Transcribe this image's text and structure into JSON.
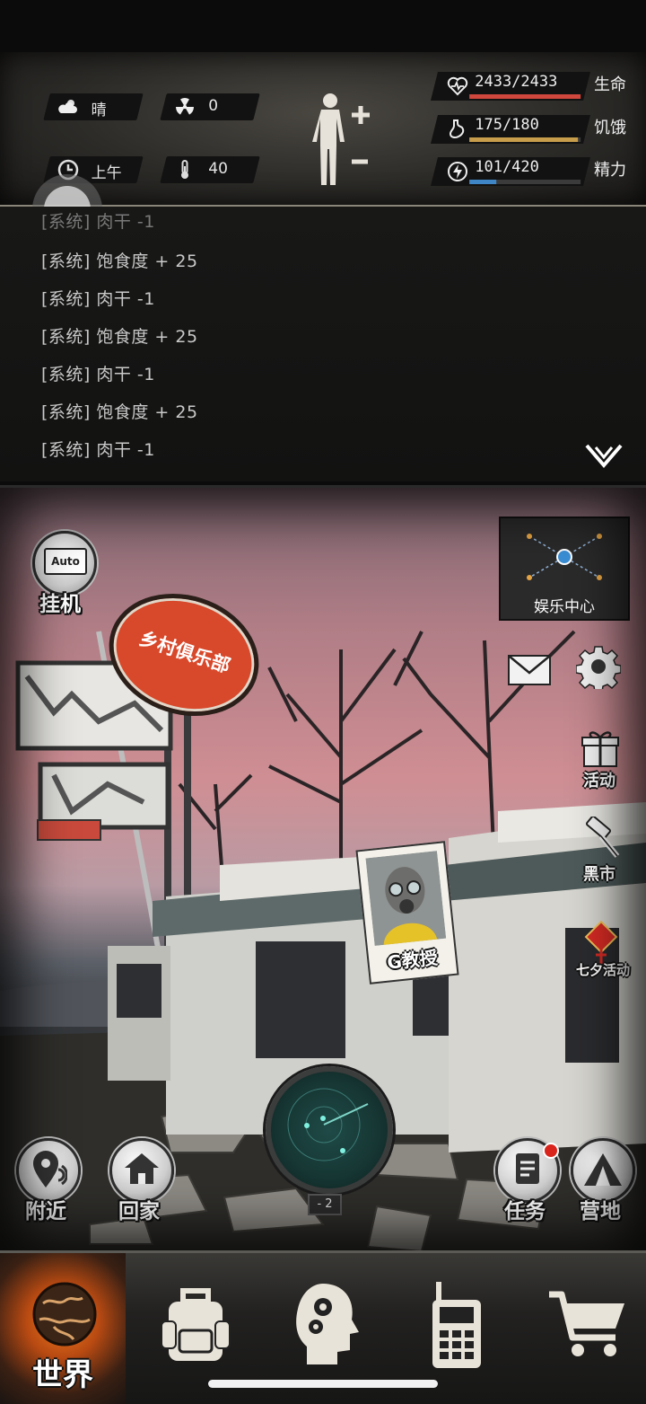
{
  "status": {
    "weather": "晴",
    "radiation": "0",
    "time_of_day": "上午",
    "temperature": "40"
  },
  "vitals": {
    "health": {
      "value": "2433/2433",
      "label": "生命",
      "fill": 1.0,
      "color": "#d0473d"
    },
    "hunger": {
      "value": "175/180",
      "label": "饥饿",
      "fill": 0.972,
      "color": "#c79d4b"
    },
    "energy": {
      "value": "101/420",
      "label": "精力",
      "fill": 0.24,
      "color": "#3f86c7"
    }
  },
  "log": {
    "lines": [
      "[系统] 肉干 -1",
      "[系统] 饱食度 + 25",
      "[系统] 肉干 -1",
      "[系统] 饱食度 + 25",
      "[系统] 肉干 -1",
      "[系统] 饱食度 + 25",
      "[系统] 肉干 -1"
    ]
  },
  "scene": {
    "club_sign": "乡村俱乐部",
    "auto_badge": "Auto",
    "idle_label": "挂机",
    "minimap_label": "娱乐中心",
    "npc_label": "G教授",
    "radar_level": "- 2",
    "activity_label": "活动",
    "black_market_label": "黑市",
    "qixi_label": "七夕活动",
    "nearby_label": "附近",
    "home_label": "回家",
    "task_label": "任务",
    "camp_label": "营地"
  },
  "nav": {
    "world_label": "世界"
  },
  "colors": {
    "accent_orange": "#e0621b",
    "sign_red": "#d8482a",
    "radar_teal": "#2f6f6a"
  }
}
